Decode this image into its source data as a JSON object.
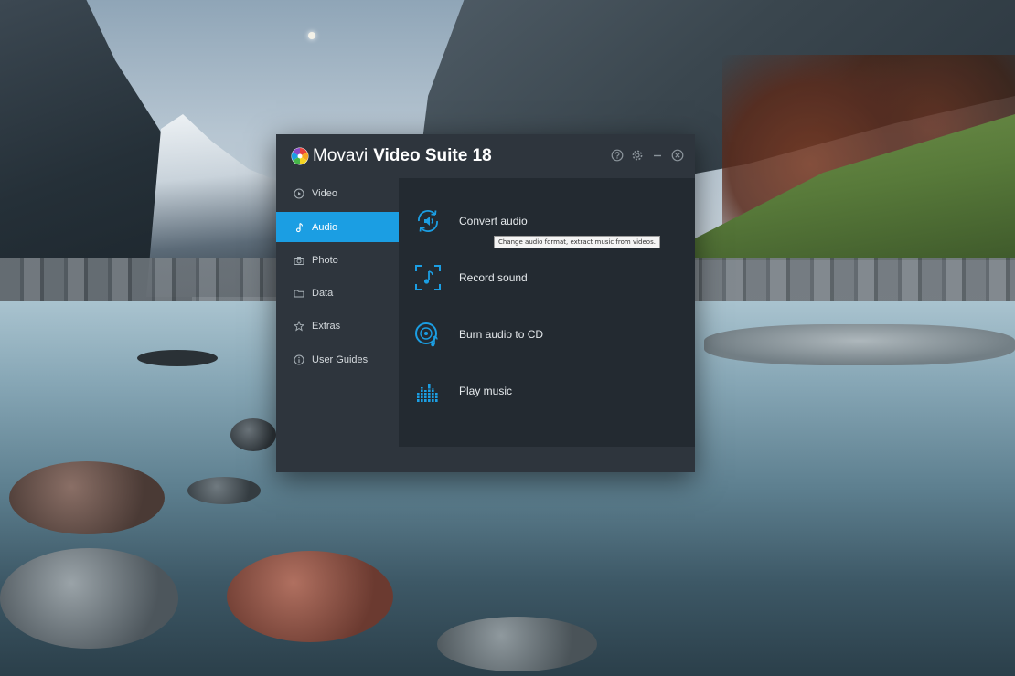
{
  "window": {
    "brand": "Movavi",
    "product": "Video Suite 18",
    "accent_color": "#1b9ee3",
    "controls": [
      "help-icon",
      "gear-icon",
      "minimize-icon",
      "close-icon"
    ]
  },
  "sidebar": {
    "items": [
      {
        "label": "Video",
        "icon": "play-circle-icon",
        "active": false
      },
      {
        "label": "Audio",
        "icon": "music-note-icon",
        "active": true
      },
      {
        "label": "Photo",
        "icon": "camera-icon",
        "active": false
      },
      {
        "label": "Data",
        "icon": "folder-icon",
        "active": false
      },
      {
        "label": "Extras",
        "icon": "star-icon",
        "active": false
      },
      {
        "label": "User Guides",
        "icon": "info-icon",
        "active": false
      }
    ]
  },
  "features": [
    {
      "label": "Convert audio",
      "icon": "convert-audio-icon"
    },
    {
      "label": "Record sound",
      "icon": "record-sound-icon"
    },
    {
      "label": "Burn audio to CD",
      "icon": "burn-cd-icon"
    },
    {
      "label": "Play music",
      "icon": "equalizer-icon"
    }
  ],
  "tooltip": {
    "text": "Change audio format, extract music from videos."
  }
}
